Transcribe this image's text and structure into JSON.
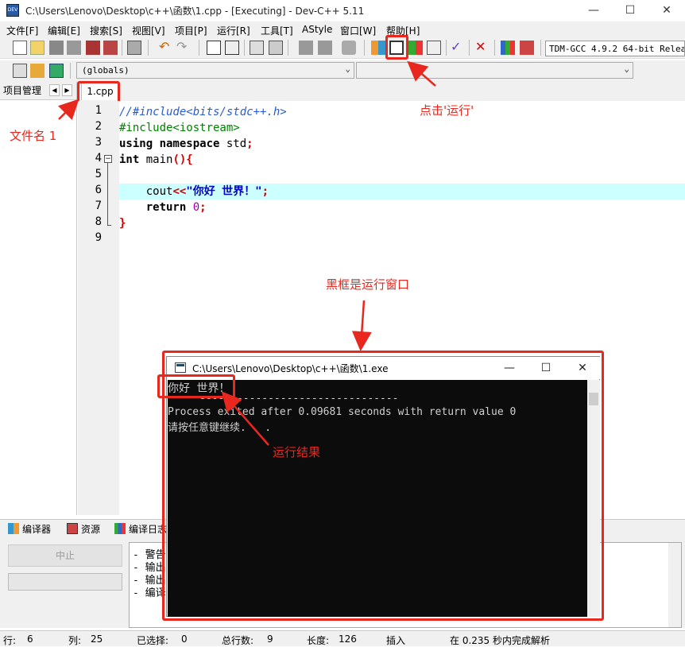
{
  "window": {
    "title": "C:\\Users\\Lenovo\\Desktop\\c++\\函数\\1.cpp - [Executing] - Dev-C++ 5.11",
    "minimize": "—",
    "maximize": "☐",
    "close": "✕"
  },
  "menu": [
    "文件[F]",
    "编辑[E]",
    "搜索[S]",
    "视图[V]",
    "项目[P]",
    "运行[R]",
    "工具[T]",
    "AStyle",
    "窗口[W]",
    "帮助[H]"
  ],
  "toolbar": {
    "compiler": "TDM-GCC 4.9.2 64-bit Release"
  },
  "scope": {
    "value": "(globals)",
    "second": ""
  },
  "left_panel": {
    "tab": "项目管理"
  },
  "editor": {
    "tab": "1.cpp",
    "line_numbers": [
      "1",
      "2",
      "3",
      "4",
      "5",
      "6",
      "7",
      "8",
      "9"
    ],
    "lines": {
      "l1": "//#include<bits/stdc++.h>",
      "l2": "#include<iostream>",
      "l3a": "using namespace",
      "l3b": " std",
      "l3c": ";",
      "l4a": "int",
      "l4b": " main",
      "l4c": "(){",
      "l6a": "    cout",
      "l6b": "<<",
      "l6c": "\"你好 世界！\"",
      "l6d": ";",
      "l7a": "    return",
      "l7b": " ",
      "l7c": "0",
      "l7d": ";",
      "l8": "}"
    }
  },
  "bottom_tabs": [
    "编译器",
    "资源",
    "编译日志"
  ],
  "bottom_panel": {
    "abort": "中止",
    "log": [
      "- 警告",
      "- 输出",
      "- 输出",
      "- 编译"
    ]
  },
  "status": {
    "row_label": "行:",
    "row": "6",
    "col_label": "列:",
    "col": "25",
    "sel_label": "已选择:",
    "sel": "0",
    "total_label": "总行数:",
    "total": "9",
    "len_label": "长度:",
    "len": "126",
    "mode": "插入",
    "parse": "在 0.235 秒内完成解析"
  },
  "console": {
    "title": "C:\\Users\\Lenovo\\Desktop\\c++\\函数\\1.exe",
    "lines": [
      "你好 世界！",
      "--------------------------------",
      "Process exited after 0.09681 seconds with return value 0",
      "请按任意键继续. . ."
    ]
  },
  "annotations": {
    "filename": "文件名 1",
    "click_run": "点击'运行'",
    "black_box": "黑框是运行窗口",
    "run_result": "运行结果"
  },
  "colors": {
    "annotation": "#e8281e",
    "highlight_line": "#ccffff",
    "console_bg": "#0c0c0c"
  }
}
